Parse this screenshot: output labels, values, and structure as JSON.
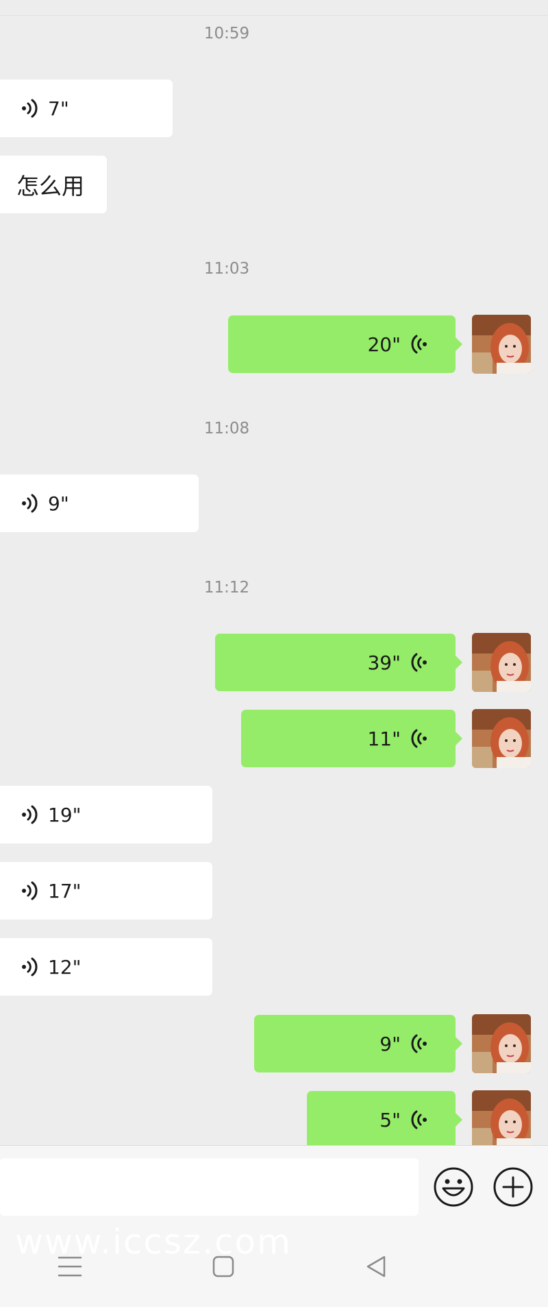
{
  "timestamps": [
    "10:59",
    "11:03",
    "11:08",
    "11:12"
  ],
  "messages": {
    "m1": {
      "duration": "7\""
    },
    "m2": {
      "text": "怎么用"
    },
    "m3": {
      "duration": "20\""
    },
    "m4": {
      "duration": "9\""
    },
    "m5": {
      "duration": "39\""
    },
    "m6": {
      "duration": "11\""
    },
    "m7": {
      "duration": "19\""
    },
    "m8": {
      "duration": "17\""
    },
    "m9": {
      "duration": "12\""
    },
    "m10": {
      "duration": "9\""
    },
    "m11": {
      "duration": "5\""
    }
  },
  "watermark": "www.iccsz.com",
  "colors": {
    "background": "#ededed",
    "outgoing_bubble": "#95ec69",
    "incoming_bubble": "#ffffff"
  },
  "icons": {
    "voice": "voice-wave-icon",
    "emoji": "emoji-icon",
    "add": "plus-icon",
    "nav": [
      "menu-icon",
      "home-icon",
      "back-icon"
    ]
  }
}
